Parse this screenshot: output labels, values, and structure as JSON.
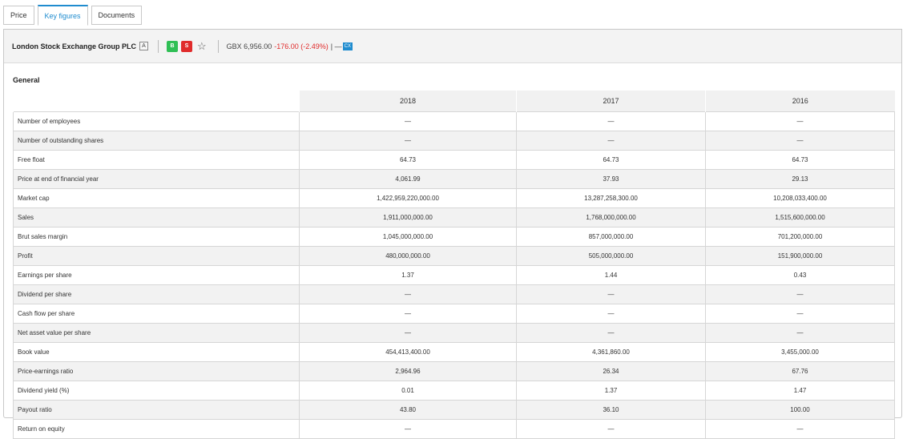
{
  "tabs": [
    "Price",
    "Key figures",
    "Documents"
  ],
  "header": {
    "company": "London Stock Exchange Group PLC",
    "badge": "A",
    "buy": "B",
    "sell": "S",
    "star_icon": "star-outline-icon",
    "price": "GBX 6,956.00",
    "change": "-176.00 (-2.49%)",
    "separator": "| —",
    "exchange": "CX",
    "colors": {
      "accent": "#1f8ccf",
      "buy": "#2fbf55",
      "sell": "#e02b2b"
    }
  },
  "section_title": "General",
  "table": {
    "years": [
      "2018",
      "2017",
      "2016"
    ],
    "rows": [
      {
        "label": "Number of employees",
        "values": [
          "—",
          "—",
          "—"
        ]
      },
      {
        "label": "Number of outstanding shares",
        "values": [
          "—",
          "—",
          "—"
        ]
      },
      {
        "label": "Free float",
        "values": [
          "64.73",
          "64.73",
          "64.73"
        ]
      },
      {
        "label": "Price at end of financial year",
        "values": [
          "4,061.99",
          "37.93",
          "29.13"
        ]
      },
      {
        "label": "Market cap",
        "values": [
          "1,422,959,220,000.00",
          "13,287,258,300.00",
          "10,208,033,400.00"
        ]
      },
      {
        "label": "Sales",
        "values": [
          "1,911,000,000.00",
          "1,768,000,000.00",
          "1,515,600,000.00"
        ]
      },
      {
        "label": "Brut sales margin",
        "values": [
          "1,045,000,000.00",
          "857,000,000.00",
          "701,200,000.00"
        ]
      },
      {
        "label": "Profit",
        "values": [
          "480,000,000.00",
          "505,000,000.00",
          "151,900,000.00"
        ]
      },
      {
        "label": "Earnings per share",
        "values": [
          "1.37",
          "1.44",
          "0.43"
        ]
      },
      {
        "label": "Dividend per share",
        "values": [
          "—",
          "—",
          "—"
        ]
      },
      {
        "label": "Cash flow per share",
        "values": [
          "—",
          "—",
          "—"
        ]
      },
      {
        "label": "Net asset value per share",
        "values": [
          "—",
          "—",
          "—"
        ]
      },
      {
        "label": "Book value",
        "values": [
          "454,413,400.00",
          "4,361,860.00",
          "3,455,000.00"
        ]
      },
      {
        "label": "Price-earnings ratio",
        "values": [
          "2,964.96",
          "26.34",
          "67.76"
        ]
      },
      {
        "label": "Dividend yield (%)",
        "values": [
          "0.01",
          "1.37",
          "1.47"
        ]
      },
      {
        "label": "Payout ratio",
        "values": [
          "43.80",
          "36.10",
          "100.00"
        ]
      },
      {
        "label": "Return on equity",
        "values": [
          "—",
          "—",
          "—"
        ]
      }
    ]
  }
}
